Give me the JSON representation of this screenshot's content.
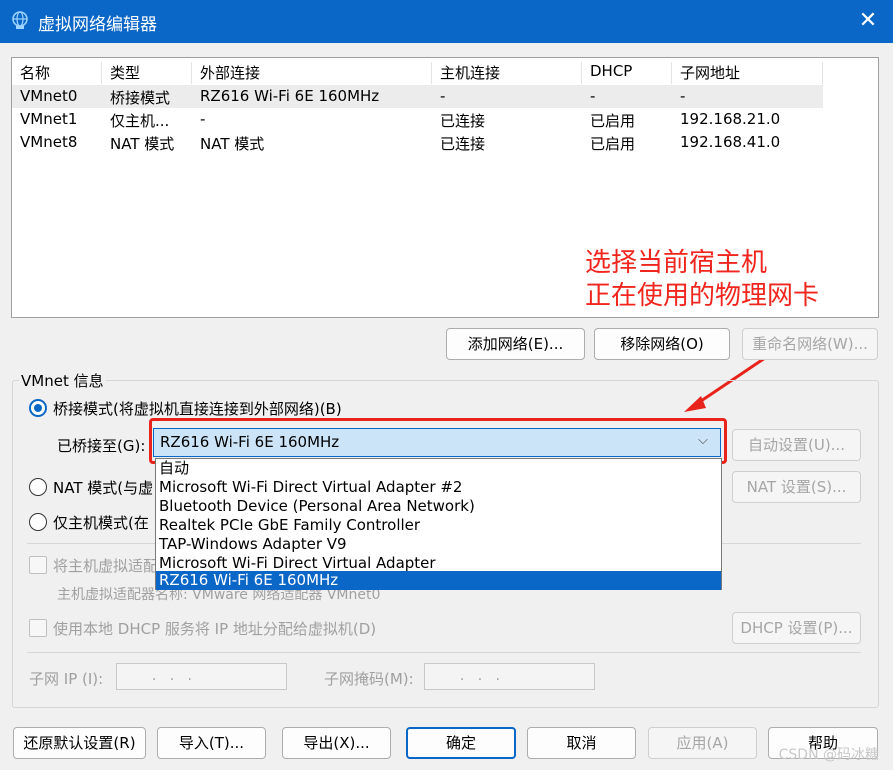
{
  "window": {
    "title": "虚拟网络编辑器",
    "close_glyph": "✕"
  },
  "table": {
    "headers": [
      "名称",
      "类型",
      "外部连接",
      "主机连接",
      "DHCP",
      "子网地址"
    ],
    "rows": [
      [
        "VMnet0",
        "桥接模式",
        "RZ616 Wi-Fi 6E 160MHz",
        "-",
        "-",
        "-"
      ],
      [
        "VMnet1",
        "仅主机...",
        "-",
        "已连接",
        "已启用",
        "192.168.21.0"
      ],
      [
        "VMnet8",
        "NAT 模式",
        "NAT 模式",
        "已连接",
        "已启用",
        "192.168.41.0"
      ]
    ]
  },
  "annotation": {
    "line1": "选择当前宿主机",
    "line2": "正在使用的物理网卡",
    "color": "#f0251d"
  },
  "net_buttons": {
    "add": "添加网络(E)...",
    "remove": "移除网络(O)",
    "rename": "重命名网络(W)..."
  },
  "vmnet_info": {
    "group_title": "VMnet 信息",
    "bridge_label": "桥接模式(将虚拟机直接连接到外部网络)(B)",
    "bridged_to_label": "已桥接至(G):",
    "bridged_to_value": "RZ616 Wi-Fi 6E 160MHz",
    "auto_settings": "自动设置(U)...",
    "nat_label": "NAT 模式(与虚",
    "nat_settings": "NAT 设置(S)...",
    "hostonly_label": "仅主机模式(在",
    "connect_adapter_label": "将主机虚拟适配",
    "adapter_name_label": "主机虚拟适配器名称: VMware 网络适配器 VMnet0",
    "dhcp_label": "使用本地 DHCP 服务将 IP 地址分配给虚拟机(D)",
    "dhcp_settings": "DHCP 设置(P)...",
    "subnet_ip_label": "子网 IP (I):",
    "subnet_mask_label": "子网掩码(M):",
    "ip_placeholder": "  .   .   .  ",
    "selected_mode": "bridge"
  },
  "dropdown": {
    "options": [
      "自动",
      "Microsoft Wi-Fi Direct Virtual Adapter #2",
      "Bluetooth Device (Personal Area Network)",
      "Realtek PCIe GbE Family Controller",
      "TAP-Windows Adapter V9",
      "Microsoft Wi-Fi Direct Virtual Adapter",
      "RZ616 Wi-Fi 6E 160MHz"
    ],
    "selected_index": 6
  },
  "footer": {
    "restore": "还原默认设置(R)",
    "import": "导入(T)...",
    "export": "导出(X)...",
    "ok": "确定",
    "cancel": "取消",
    "apply": "应用(A)",
    "help": "帮助"
  },
  "watermark": "CSDN @码冰糖",
  "colors": {
    "accent": "#0a67c7",
    "highlight_box": "#e8231b"
  }
}
